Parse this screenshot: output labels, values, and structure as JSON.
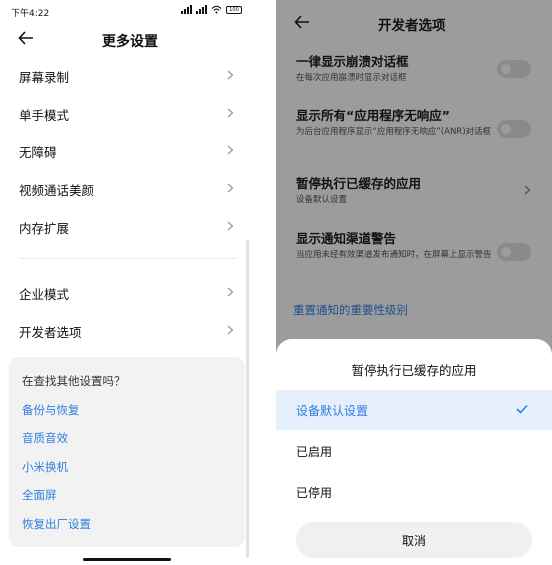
{
  "status_bar": {
    "time": "下午4:22",
    "battery": "100"
  },
  "left": {
    "title": "更多设置",
    "items": [
      {
        "label": "屏幕录制"
      },
      {
        "label": "单手模式"
      },
      {
        "label": "无障碍"
      },
      {
        "label": "视频通话美颜"
      },
      {
        "label": "内存扩展"
      },
      {
        "label": "企业模式"
      },
      {
        "label": "开发者选项"
      }
    ],
    "suggestions": {
      "title": "在查找其他设置吗？",
      "links": [
        "备份与恢复",
        "音质音效",
        "小米换机",
        "全面屏",
        "恢复出厂设置"
      ]
    }
  },
  "right": {
    "title": "开发者选项",
    "options": [
      {
        "title": "一律显示崩溃对话框",
        "desc": "在每次应用崩溃时显示对话框",
        "enabled": false
      },
      {
        "title": "显示所有“应用程序无响应”",
        "desc": "为后台应用程序显示“应用程序无响应”(ANR)对话框",
        "enabled": false
      },
      {
        "title": "暂停执行已缓存的应用",
        "desc": "设备默认设置"
      },
      {
        "title": "显示通知渠道警告",
        "desc": "当应用未经有效渠道发布通知时，在屏幕上显示警告",
        "enabled": false
      }
    ],
    "link": "重置通知的重要性级别",
    "sheet": {
      "title": "暂停执行已缓存的应用",
      "options": [
        "设备默认设置",
        "已启用",
        "已停用"
      ],
      "selected": "设备默认设置",
      "cancel": "取消"
    }
  },
  "colors": {
    "accent": "#2f7de1",
    "scrim": "#9c9c9c",
    "selected_bg": "#e6f0fc"
  }
}
